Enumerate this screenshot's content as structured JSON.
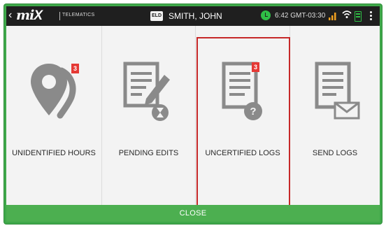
{
  "status_bar": {
    "back_glyph": "‹",
    "logo_text": "mi",
    "logo_x": "X",
    "brand_text": "TELEMATICS",
    "eld_badge": "ELD",
    "driver_name": "SMITH, JOHN",
    "time_text": "6:42 GMT-03:30"
  },
  "tiles": [
    {
      "label": "UNIDENTIFIED HOURS",
      "badge": "3"
    },
    {
      "label": "PENDING EDITS"
    },
    {
      "label": "UNCERTIFIED LOGS",
      "badge": "3"
    },
    {
      "label": "SEND LOGS"
    }
  ],
  "close_label": "CLOSE",
  "colors": {
    "status_bg": "#1f1f1f",
    "tile_bg": "#f3f3f3",
    "icon_gray": "#8a8a8a",
    "badge_red": "#e53935",
    "selection_border": "#c62828",
    "close_green": "#4caf50",
    "frame_green": "#3fa84a"
  }
}
